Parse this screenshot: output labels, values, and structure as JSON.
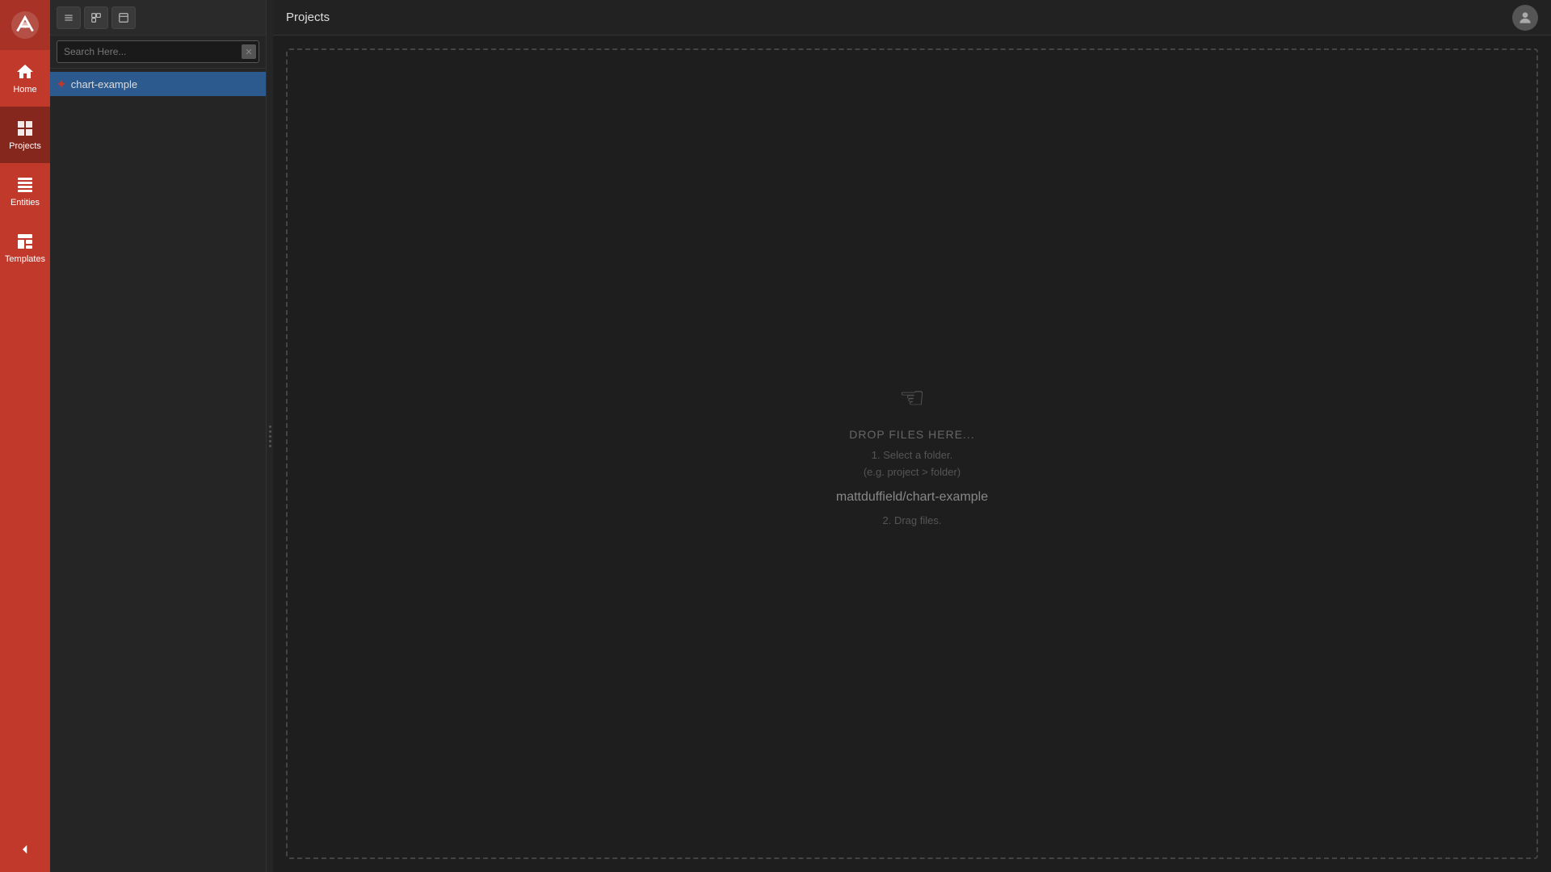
{
  "app": {
    "title": "Projects"
  },
  "sidebar": {
    "nav_items": [
      {
        "id": "home",
        "label": "Home",
        "active": false
      },
      {
        "id": "projects",
        "label": "Projects",
        "active": true
      },
      {
        "id": "entities",
        "label": "Entities",
        "active": false
      },
      {
        "id": "templates",
        "label": "Templates",
        "active": false
      }
    ],
    "collapse_label": "Collapse"
  },
  "panel": {
    "toolbar": {
      "btn1_icon": "≡",
      "btn2_icon": "⧉",
      "btn3_icon": "⊟"
    },
    "search": {
      "placeholder": "Search Here...",
      "value": "",
      "clear_label": "✕"
    },
    "projects": [
      {
        "id": "chart-example",
        "label": "chart-example",
        "icon": "+"
      }
    ]
  },
  "dropzone": {
    "drop_text": "DROP FILES HERE...",
    "step1_label": "1. Select a folder.",
    "step1_hint": "(e.g. project > folder)",
    "project_name": "mattduffield/chart-example",
    "step2_label": "2. Drag files."
  }
}
